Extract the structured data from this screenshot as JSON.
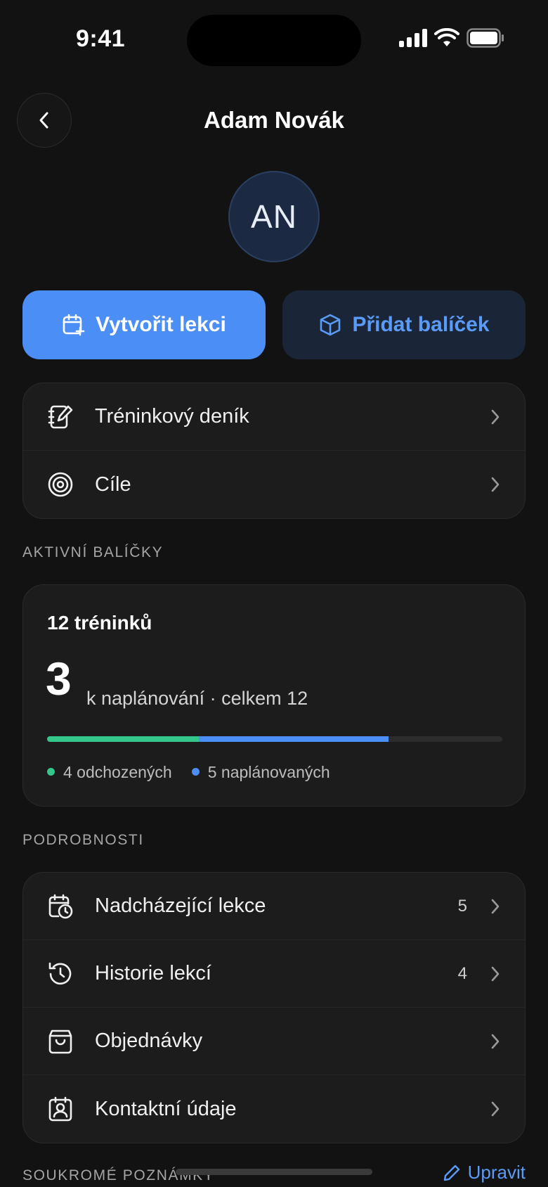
{
  "status_bar": {
    "time": "9:41"
  },
  "nav": {
    "title": "Adam Novák"
  },
  "avatar": {
    "initials": "AN"
  },
  "actions": {
    "create_lesson": "Vytvořit lekci",
    "add_package": "Přidat balíček"
  },
  "menu_top": [
    {
      "label": "Tréninkový deník",
      "icon": "notebook-edit-icon"
    },
    {
      "label": "Cíle",
      "icon": "target-icon"
    }
  ],
  "active_packages": {
    "section_label": "AKTIVNÍ BALÍČKY",
    "title": "12 tréninků",
    "remaining": "3",
    "remaining_text": "k naplánování · celkem 12",
    "total": 12,
    "done": 4,
    "scheduled": 5,
    "legend_done": "4 odchozených",
    "legend_scheduled": "5 naplánovaných",
    "colors": {
      "done": "#34c78a",
      "scheduled": "#4b8ef5",
      "track": "#2c2c2c"
    }
  },
  "details": {
    "section_label": "PODROBNOSTI",
    "items": [
      {
        "label": "Nadcházející lekce",
        "count": "5",
        "icon": "calendar-clock-icon"
      },
      {
        "label": "Historie lekcí",
        "count": "4",
        "icon": "history-icon"
      },
      {
        "label": "Objednávky",
        "count": "",
        "icon": "shopping-bag-icon"
      },
      {
        "label": "Kontaktní údaje",
        "count": "",
        "icon": "contact-card-icon"
      }
    ]
  },
  "notes": {
    "section_label": "SOUKROMÉ POZNÁMKY",
    "edit_label": "Upravit"
  },
  "colors": {
    "accent": "#4b8ef5",
    "background": "#121212",
    "card": "#1c1c1c"
  }
}
